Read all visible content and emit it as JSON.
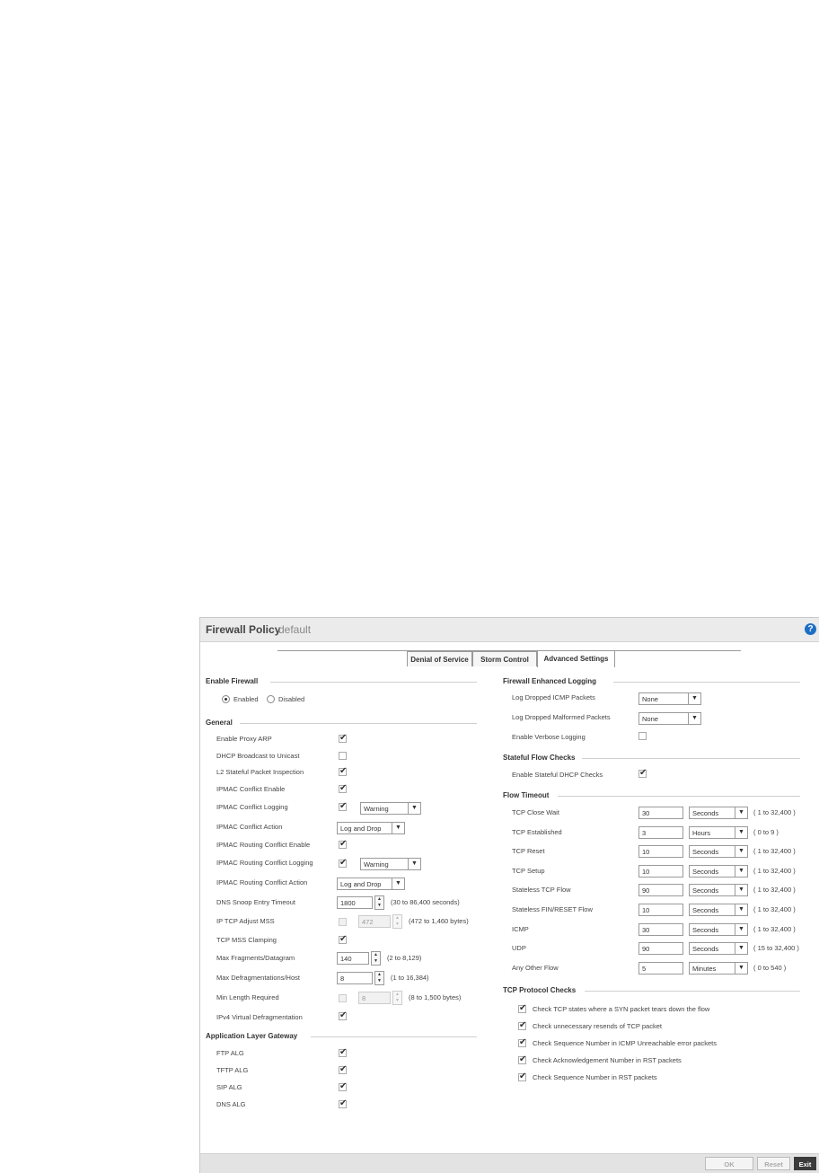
{
  "panel": {
    "title": "Firewall Policy",
    "subtitle": "default",
    "help": "?"
  },
  "tabs": [
    "Denial of Service",
    "Storm Control",
    "Advanced Settings"
  ],
  "enable_firewall": {
    "heading": "Enable Firewall",
    "enabled_label": "Enabled",
    "disabled_label": "Disabled",
    "value": "Enabled"
  },
  "general": {
    "heading": "General",
    "rows": [
      {
        "label": "Enable Proxy ARP",
        "checked": true
      },
      {
        "label": "DHCP Broadcast to Unicast",
        "checked": false
      },
      {
        "label": "L2 Stateful Packet Inspection",
        "checked": true
      },
      {
        "label": "IPMAC Conflict Enable",
        "checked": true
      },
      {
        "label": "IPMAC Conflict Logging",
        "checked": true,
        "select": "Warning"
      },
      {
        "label": "IPMAC Conflict Action",
        "select": "Log and Drop"
      },
      {
        "label": "IPMAC Routing Conflict Enable",
        "checked": true
      },
      {
        "label": "IPMAC Routing Conflict Logging",
        "checked": true,
        "select": "Warning"
      },
      {
        "label": "IPMAC Routing Conflict Action",
        "select": "Log and Drop"
      },
      {
        "label": "DNS Snoop Entry Timeout",
        "value": "1800",
        "hint": "(30 to 86,400 seconds)"
      },
      {
        "label": "IP TCP Adjust MSS",
        "checked": false,
        "value": "472",
        "hint": "(472 to 1,460 bytes)"
      },
      {
        "label": "TCP MSS Clamping",
        "checked": true
      },
      {
        "label": "Max Fragments/Datagram",
        "value": "140",
        "hint": "(2 to 8,129)"
      },
      {
        "label": "Max Defragmentations/Host",
        "value": "8",
        "hint": "(1 to 16,384)"
      },
      {
        "label": "Min Length Required",
        "checked": false,
        "value": "8",
        "hint": "(8 to 1,500 bytes)"
      },
      {
        "label": "IPv4 Virtual Defragmentation",
        "checked": true
      }
    ]
  },
  "alg": {
    "heading": "Application Layer Gateway",
    "rows": [
      {
        "label": "FTP ALG",
        "checked": true
      },
      {
        "label": "TFTP ALG",
        "checked": true
      },
      {
        "label": "SIP ALG",
        "checked": true
      },
      {
        "label": "DNS ALG",
        "checked": true
      }
    ]
  },
  "logging": {
    "heading": "Firewall Enhanced Logging",
    "icmp_label": "Log Dropped ICMP Packets",
    "icmp_value": "None",
    "malformed_label": "Log Dropped Malformed Packets",
    "malformed_value": "None",
    "verbose_label": "Enable Verbose Logging"
  },
  "stateful": {
    "heading": "Stateful Flow Checks",
    "dhcp_label": "Enable Stateful DHCP Checks"
  },
  "flow_timeout": {
    "heading": "Flow Timeout",
    "rows": [
      {
        "label": "TCP Close Wait",
        "value": "30",
        "unit": "Seconds",
        "range": "( 1 to 32,400 )"
      },
      {
        "label": "TCP Established",
        "value": "3",
        "unit": "Hours",
        "range": "( 0 to 9 )"
      },
      {
        "label": "TCP Reset",
        "value": "10",
        "unit": "Seconds",
        "range": "( 1 to 32,400 )"
      },
      {
        "label": "TCP Setup",
        "value": "10",
        "unit": "Seconds",
        "range": "( 1 to 32,400 )"
      },
      {
        "label": "Stateless TCP Flow",
        "value": "90",
        "unit": "Seconds",
        "range": "( 1 to 32,400 )"
      },
      {
        "label": "Stateless FIN/RESET Flow",
        "value": "10",
        "unit": "Seconds",
        "range": "( 1 to 32,400 )"
      },
      {
        "label": "ICMP",
        "value": "30",
        "unit": "Seconds",
        "range": "( 1 to 32,400 )"
      },
      {
        "label": "UDP",
        "value": "90",
        "unit": "Seconds",
        "range": "( 15 to 32,400 )"
      },
      {
        "label": "Any Other Flow",
        "value": "5",
        "unit": "Minutes",
        "range": "( 0 to 540 )"
      }
    ]
  },
  "tcp_checks": {
    "heading": "TCP Protocol Checks",
    "rows": [
      "Check TCP states where a SYN packet tears down the flow",
      "Check unnecessary resends of TCP packet",
      "Check Sequence Number in ICMP Unreachable error packets",
      "Check Acknowledgement Number in RST packets",
      "Check Sequence Number in RST packets"
    ]
  },
  "footer": {
    "ok": "OK",
    "reset": "Reset",
    "exit": "Exit"
  },
  "colors": {
    "help_blue": "#1d6fc4",
    "exit_bg": "#3b3b3b"
  }
}
